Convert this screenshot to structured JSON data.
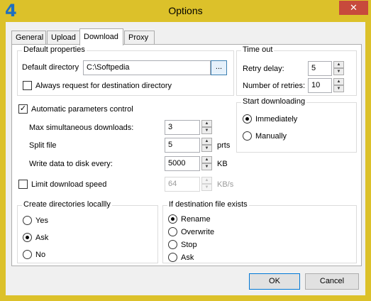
{
  "window": {
    "title": "Options",
    "app_icon": "4",
    "close_glyph": "✕"
  },
  "tabs": [
    {
      "label": "General",
      "active": false
    },
    {
      "label": "Upload",
      "active": false
    },
    {
      "label": "Download",
      "active": true
    },
    {
      "label": "Proxy",
      "active": false
    }
  ],
  "default_properties": {
    "legend": "Default properties",
    "directory_label": "Default directory",
    "directory_value": "C:\\Softpedia",
    "browse_label": "...",
    "always_request_label": "Always request for destination directory",
    "always_request_checked": false
  },
  "time_out": {
    "legend": "Time out",
    "retry_delay_label": "Retry delay:",
    "retry_delay_value": "5",
    "retries_label": "Number of retries:",
    "retries_value": "10"
  },
  "auto_params": {
    "label": "Automatic parameters control",
    "checked": true,
    "max_downloads_label": "Max simultaneous downloads:",
    "max_downloads_value": "3",
    "split_label": "Split file",
    "split_value": "5",
    "split_unit": "prts",
    "write_label": "Write data to disk every:",
    "write_value": "5000",
    "write_unit": "KB"
  },
  "limit_speed": {
    "label": "Limit download speed",
    "checked": false,
    "value": "64",
    "unit": "KB/s"
  },
  "start_downloading": {
    "legend": "Start downloading",
    "options": [
      "Immediately",
      "Manually"
    ],
    "selected": "Immediately"
  },
  "create_dirs": {
    "legend": "Create directories locallly",
    "options": [
      "Yes",
      "Ask",
      "No"
    ],
    "selected": "Ask"
  },
  "if_exists": {
    "legend": "If destination file exists",
    "options": [
      "Rename",
      "Overwrite",
      "Stop",
      "Ask"
    ],
    "selected": "Rename"
  },
  "buttons": {
    "ok": "OK",
    "cancel": "Cancel"
  }
}
